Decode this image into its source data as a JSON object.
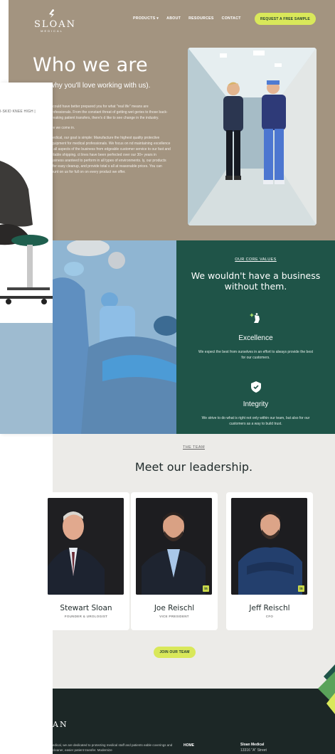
{
  "brand": {
    "name": "SLOAN",
    "tagline": "MEDICAL"
  },
  "nav": {
    "items": [
      "PRODUCTS ▾",
      "ABOUT",
      "RESOURCES",
      "CONTACT"
    ],
    "cta": "REQUEST A FREE SAMPLE"
  },
  "hero": {
    "title": "Who we are",
    "subtitle": "why you'll love working with us).",
    "paragraphs": [
      "d could have better prepared you for what \"real life\" means are professionals. From the constant threat of getting wet geries to those back-breaking patient transfers, there's d like to see change in the industry.",
      "ere we come in.",
      "Medical, our goal is simple: Manufacture the highest quality protective equipment for medical professionals. We focus on nd maintaining excellence in all aspects of the business from edgeable customer service to our fast and reliable shipping. ct lines have been perfected over our 30+ years in business aranteed to perform in all types of environments. ly, our products offer easy cleanup, and provide total s all at reasonable prices. You can count on us for full on on every product we offer."
    ]
  },
  "overlay": {
    "label": "I-SKID KNEE HIGH  |"
  },
  "values": {
    "eyebrow": "OUR CORE VALUES",
    "heading": "We wouldn't have a business without them.",
    "items": [
      {
        "icon": "hand-sparkle-icon",
        "title": "Excellence",
        "desc": "We expect the best from ourselves in an effort to always provide the best for our customers."
      },
      {
        "icon": "shield-check-icon",
        "title": "Integrity",
        "desc": "We strive to do what is right not only within our team, but also for our customers as a way to build trust."
      }
    ]
  },
  "team": {
    "eyebrow": "THE TEAM",
    "heading": "Meet our leadership.",
    "members": [
      {
        "name": "Stewart Sloan",
        "role": "FOUNDER & UROLOGIST"
      },
      {
        "name": "Joe Reischl",
        "role": "VICE PRESIDENT",
        "badge": "in"
      },
      {
        "name": "Jeff Reischl",
        "role": "CFO",
        "badge": "in"
      }
    ],
    "cta": "JOIN OUR TEAM"
  },
  "footer": {
    "logo": "AN",
    "text": "edical, we are dedicated to protecting medical staff and patients eable coverings and cleaner, easier patient transfer. Modernize",
    "nav_home": "HOME",
    "company": "Sloan Medical",
    "street": "13316 \"A\" Street"
  },
  "colors": {
    "hero_bg": "#a39480",
    "values_bg": "#1f5448",
    "accent": "#d9e85a",
    "footer_bg": "#1c2726",
    "team_bg": "#ecebe8"
  }
}
